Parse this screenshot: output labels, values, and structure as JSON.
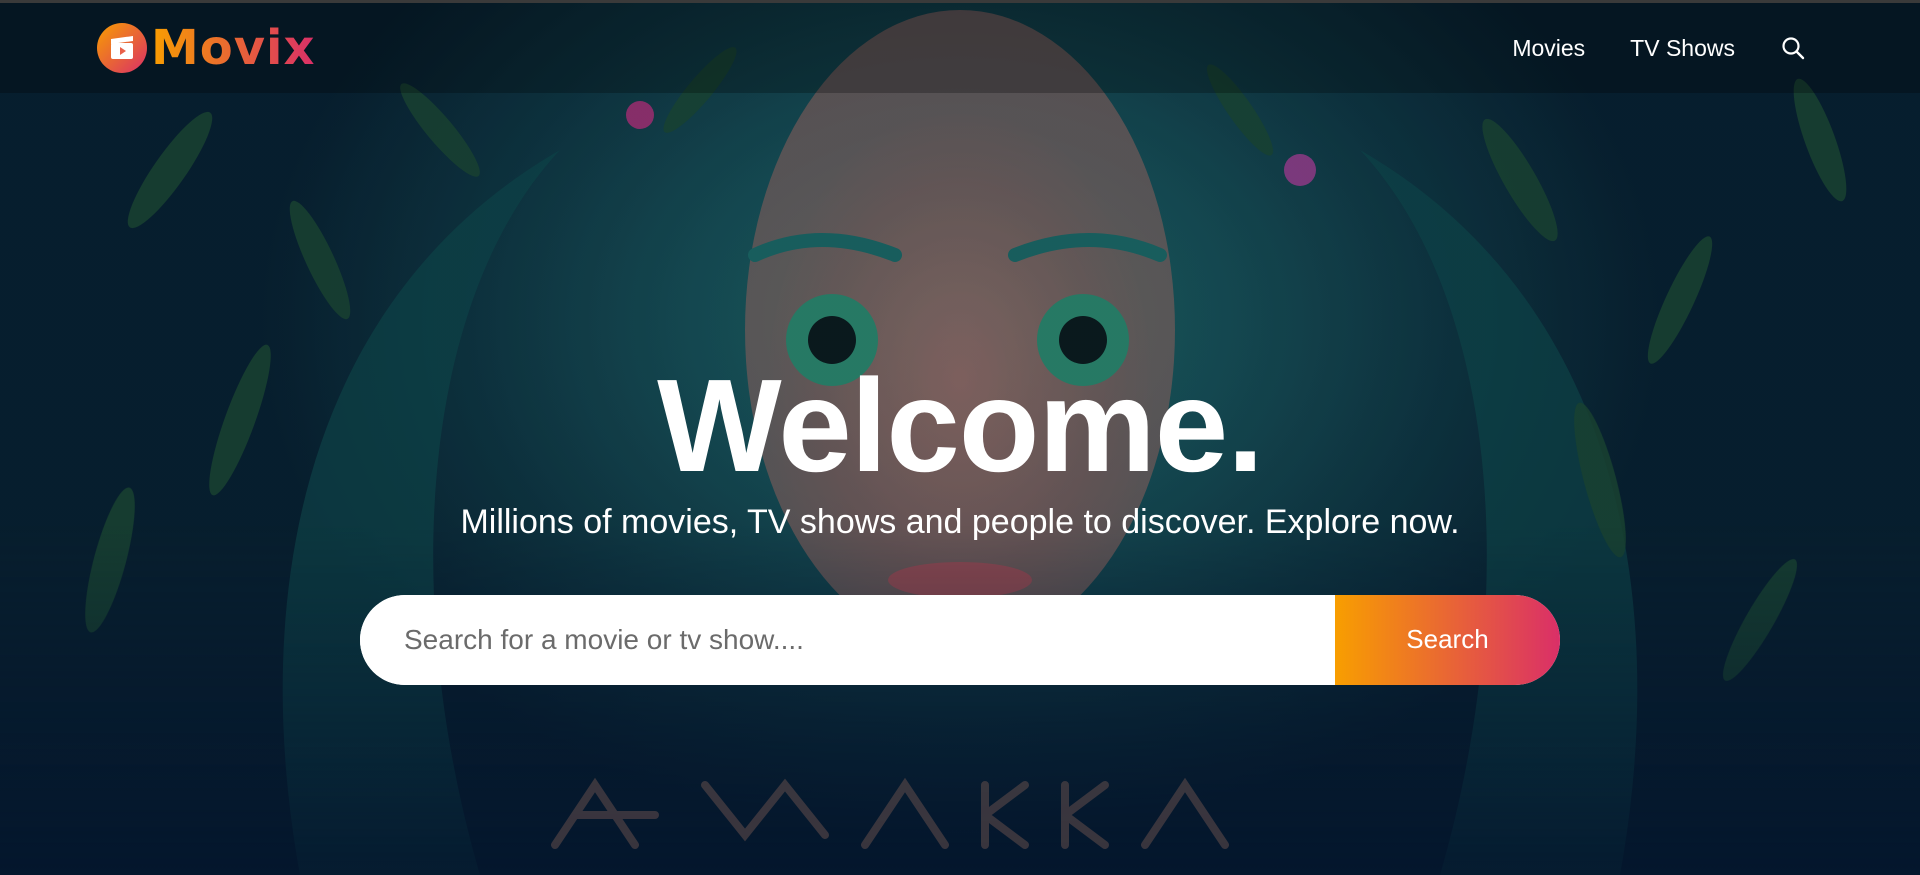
{
  "header": {
    "logo_text": "Movix",
    "nav": [
      {
        "label": "Movies"
      },
      {
        "label": "TV Shows"
      }
    ],
    "search_icon": "search-icon"
  },
  "hero": {
    "title": "Welcome.",
    "subtitle": "Millions of movies, TV shows and people to discover. Explore now.",
    "search": {
      "placeholder": "Search for a movie or tv show....",
      "value": "",
      "button_label": "Search"
    }
  },
  "colors": {
    "accent_start": "#f89e00",
    "accent_end": "#da2f68",
    "background": "#04152d"
  }
}
